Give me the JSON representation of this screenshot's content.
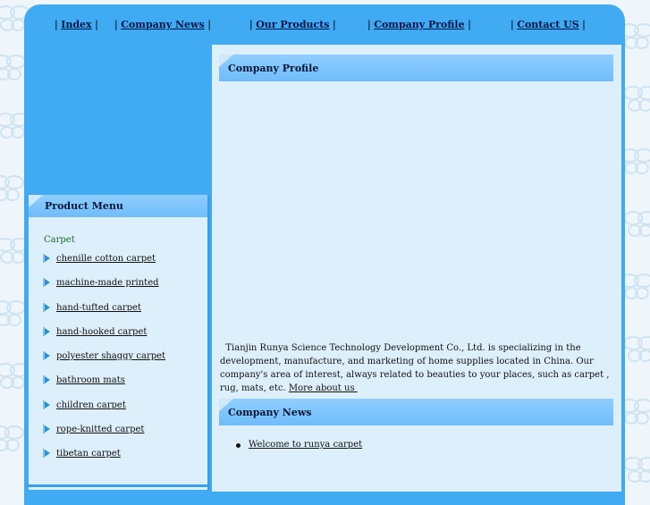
{
  "nav": {
    "sep": "|",
    "items": [
      "Index",
      "Company News",
      "Our Products",
      "Company Profile",
      "Contact US"
    ]
  },
  "left": {
    "menu_title": "Product Menu",
    "category": "Carpet",
    "items": [
      "chenille cotton carpet",
      "machine-made printed",
      "hand-tufted carpet",
      "hand-hooked carpet",
      "polyester shaggy carpet",
      "bathroom mats",
      "children carpet",
      "rope-knitted carpet",
      "tibetan carpet"
    ]
  },
  "main": {
    "profile_title": "Company Profile",
    "profile_text": "Tianjin Runya Science Technology Development Co., Ltd. is specializing in the development, manufacture, and marketing of home supplies located in China. Our company's area of interest, always related to beauties to your places, such as carpet , rug, mats, etc.",
    "more_link": "More about us",
    "news_title": "Company News",
    "news_items": [
      "Welcome to runya carpet"
    ]
  },
  "colors": {
    "frame": "#40aaf2",
    "panel": "#ddeffb",
    "header": "#7fc4fb"
  }
}
